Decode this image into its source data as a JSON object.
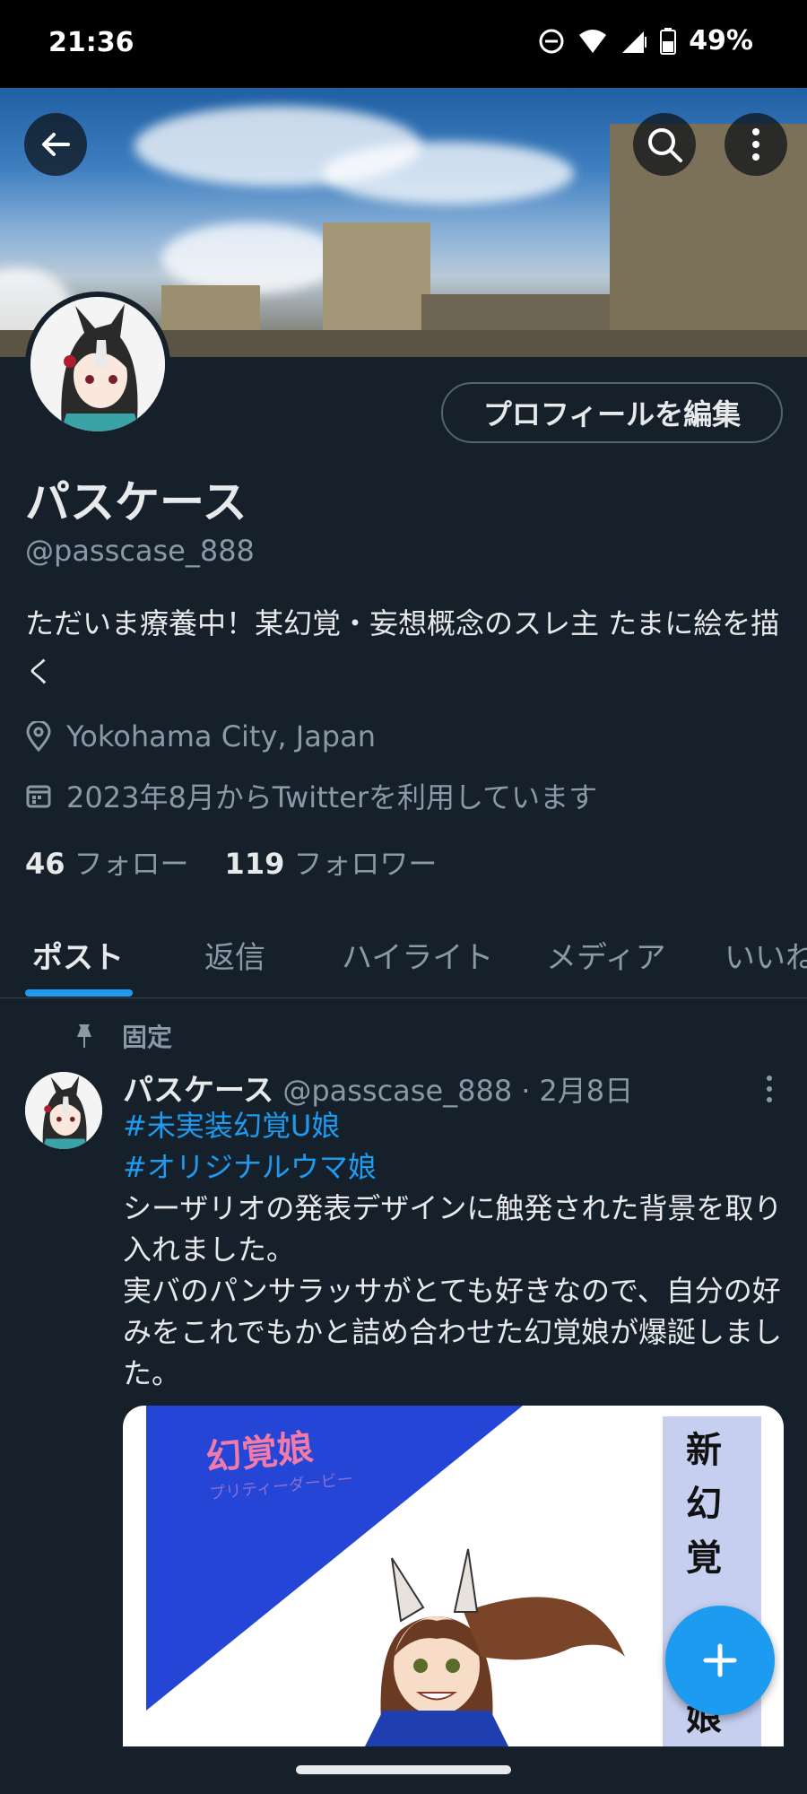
{
  "status_bar": {
    "time": "21:36",
    "battery": "49%",
    "icons": [
      "do-not-disturb-icon",
      "wifi-icon",
      "signal-icon",
      "battery-icon"
    ]
  },
  "header": {
    "icons": [
      "back-arrow-icon",
      "search-icon",
      "more-vertical-icon"
    ]
  },
  "profile": {
    "edit_button": "プロフィールを編集",
    "display_name": "パスケース",
    "handle": "@passcase_888",
    "bio": "ただいま療養中！某幻覚・妄想概念のスレ主 たまに絵を描く",
    "location": "Yokohama City, Japan",
    "joined": "2023年8月からTwitterを利用しています",
    "following_count": "46",
    "following_label": "フォロー",
    "followers_count": "119",
    "followers_label": "フォロワー"
  },
  "tabs": [
    {
      "label": "ポスト",
      "active": true
    },
    {
      "label": "返信"
    },
    {
      "label": "ハイライト"
    },
    {
      "label": "メディア"
    },
    {
      "label": "いいね"
    }
  ],
  "post": {
    "pinned_label": "固定",
    "author_name": "パスケース",
    "author_handle": "@passcase_888",
    "separator": "·",
    "date": "2月8日",
    "hashtags": [
      "#未実装幻覚U娘",
      "#オリジナルウマ娘"
    ],
    "text_lines": [
      "シーザリオの発表デザインに触発された背景を取り入れました。",
      "実バのパンサラッサがとても好きなので、自分の好みをこれでもかと詰め合わせた幻覚娘が爆誕しました。"
    ],
    "media": {
      "logo_text": "幻覚娘",
      "logo_sub": "プリティーダービー",
      "vertical_text": "新幻覚",
      "vertical_text_2": "娘"
    }
  },
  "fab": {
    "icon": "plus-icon"
  },
  "colors": {
    "background": "#15202b",
    "accent": "#1d9bf0",
    "secondary_text": "#8b98a5",
    "border": "#38444d"
  }
}
